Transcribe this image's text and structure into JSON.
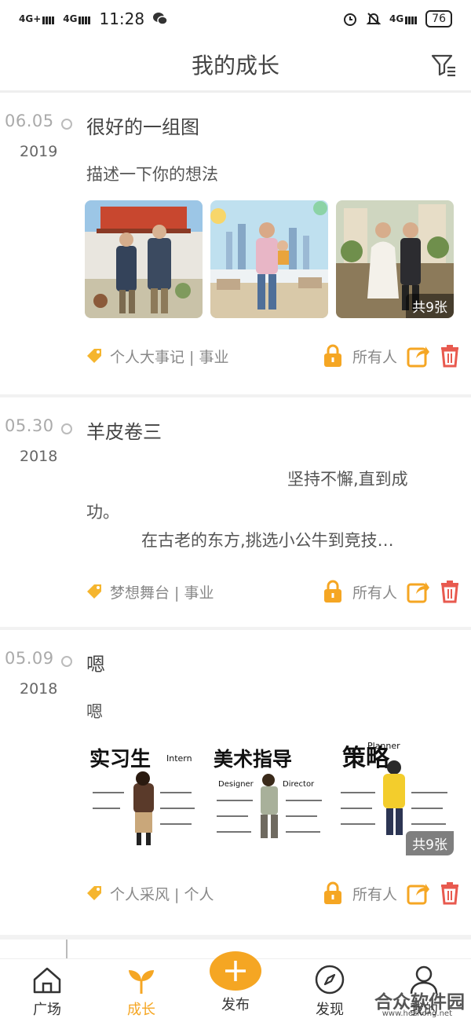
{
  "status_bar": {
    "net1": "4G+",
    "net2": "4G",
    "time": "11:28",
    "net3": "4G",
    "battery": "76"
  },
  "header": {
    "title": "我的成长"
  },
  "posts": [
    {
      "date": "06.05",
      "year": "2019",
      "title": "很好的一组图",
      "desc": "描述一下你的想法",
      "count": "共9张",
      "tags": "个人大事记 | 事业",
      "visibility": "所有人"
    },
    {
      "date": "05.30",
      "year": "2018",
      "title": "羊皮卷三",
      "desc_line1": "坚持不懈,直到成",
      "desc_line2": "功。",
      "desc_line3": "在古老的东方,挑选小公牛到竞技…",
      "tags": "梦想舞台 | 事业",
      "visibility": "所有人"
    },
    {
      "date": "05.09",
      "year": "2018",
      "title": "嗯",
      "desc": "嗯",
      "count": "共9张",
      "tags": "个人采风 | 个人",
      "visibility": "所有人",
      "illustration": {
        "t1": "实习生",
        "t2": "美术指导",
        "t3": "策略",
        "s1": "Intern",
        "s2": "Designer",
        "s3": "Director",
        "s4": "Planner"
      }
    }
  ],
  "tabs": [
    {
      "label": "广场",
      "icon": "home-icon"
    },
    {
      "label": "成长",
      "icon": "sprout-icon"
    },
    {
      "label": "发布",
      "icon": "plus-icon"
    },
    {
      "label": "发现",
      "icon": "compass-icon"
    },
    {
      "label": "我的",
      "icon": "person-icon"
    }
  ],
  "watermark": {
    "text": "合众软件园",
    "url": "www.hezhong.net"
  },
  "colors": {
    "accent": "#f5a623",
    "delete": "#e85a4f"
  }
}
